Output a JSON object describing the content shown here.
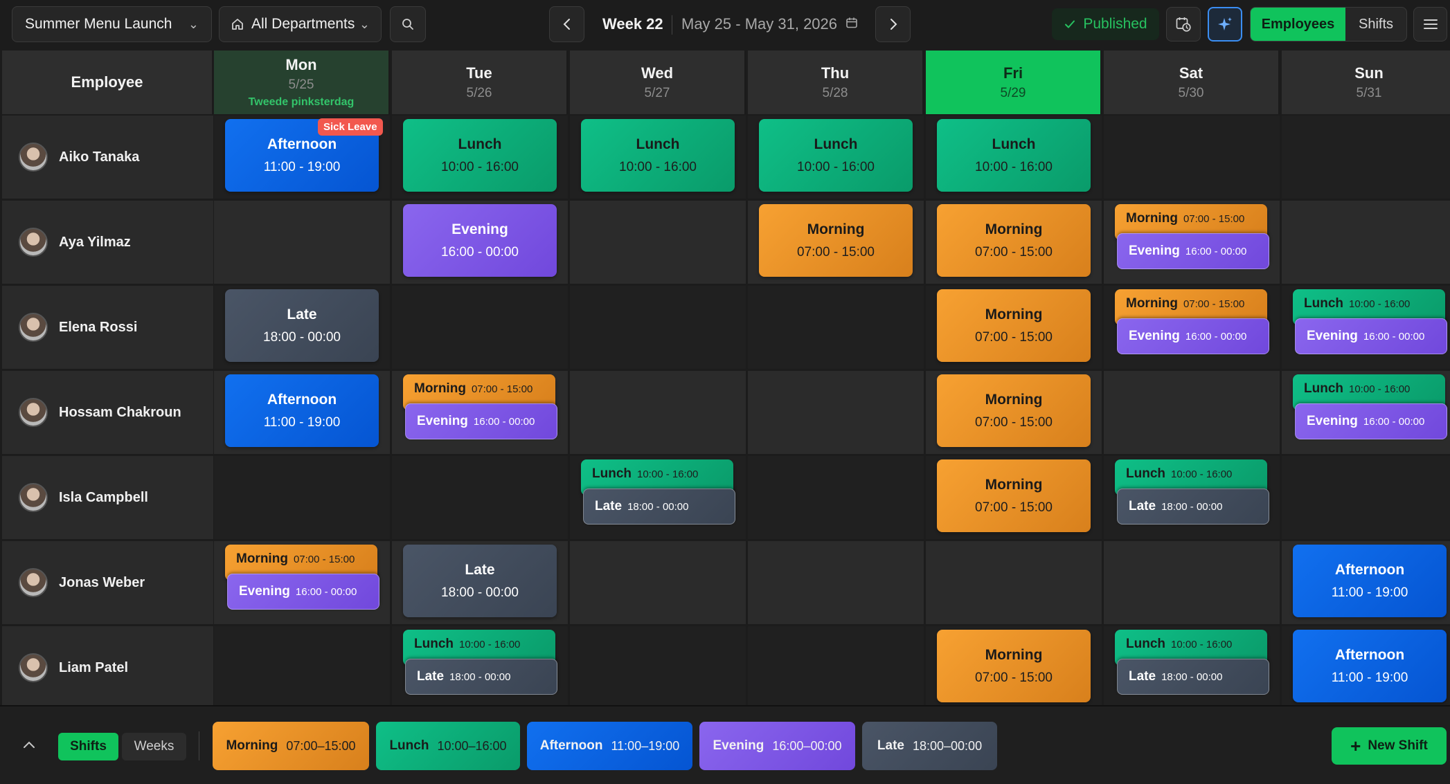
{
  "toolbar": {
    "project": "Summer Menu Launch",
    "department": "All Departments",
    "week_label": "Week 22",
    "date_range": "May 25 - May 31, 2026",
    "published": "Published",
    "view_employees": "Employees",
    "view_shifts": "Shifts",
    "accent": "#10c35c"
  },
  "grid": {
    "employee_header": "Employee",
    "days": [
      {
        "day": "Mon",
        "date": "5/25",
        "holiday": "Tweede pinksterdag"
      },
      {
        "day": "Tue",
        "date": "5/26",
        "holiday": ""
      },
      {
        "day": "Wed",
        "date": "5/27",
        "holiday": ""
      },
      {
        "day": "Thu",
        "date": "5/28",
        "holiday": ""
      },
      {
        "day": "Fri",
        "date": "5/29",
        "holiday": ""
      },
      {
        "day": "Sat",
        "date": "5/30",
        "holiday": ""
      },
      {
        "day": "Sun",
        "date": "5/31",
        "holiday": ""
      }
    ],
    "employees": [
      {
        "name": "Aiko Tanaka",
        "shifts": [
          [
            "Afternoon"
          ],
          [
            "Lunch"
          ],
          [
            "Lunch"
          ],
          [
            "Lunch"
          ],
          [
            "Lunch"
          ],
          [],
          []
        ],
        "badges": {
          "0": "Sick Leave"
        }
      },
      {
        "name": "Aya Yilmaz",
        "shifts": [
          [],
          [
            "Evening"
          ],
          [],
          [
            "Morning"
          ],
          [
            "Morning"
          ],
          [
            "Morning",
            "Evening"
          ],
          []
        ]
      },
      {
        "name": "Elena Rossi",
        "shifts": [
          [
            "Late"
          ],
          [],
          [],
          [],
          [
            "Morning"
          ],
          [
            "Morning",
            "Evening"
          ],
          [
            "Lunch",
            "Evening"
          ]
        ]
      },
      {
        "name": "Hossam Chakroun",
        "shifts": [
          [
            "Afternoon"
          ],
          [
            "Morning",
            "Evening"
          ],
          [],
          [],
          [
            "Morning"
          ],
          [],
          [
            "Lunch",
            "Evening"
          ]
        ]
      },
      {
        "name": "Isla Campbell",
        "shifts": [
          [],
          [],
          [
            "Lunch",
            "Late"
          ],
          [],
          [
            "Morning"
          ],
          [
            "Lunch",
            "Late"
          ],
          []
        ]
      },
      {
        "name": "Jonas Weber",
        "shifts": [
          [
            "Morning",
            "Evening"
          ],
          [
            "Late"
          ],
          [],
          [],
          [],
          [],
          [
            "Afternoon"
          ]
        ]
      },
      {
        "name": "Liam Patel",
        "shifts": [
          [],
          [
            "Lunch",
            "Late"
          ],
          [],
          [],
          [
            "Morning"
          ],
          [
            "Lunch",
            "Late"
          ],
          [
            "Afternoon"
          ]
        ]
      }
    ]
  },
  "shift_types": {
    "Morning": {
      "name": "Morning",
      "time": "07:00 - 15:00",
      "legend_time": "07:00–15:00",
      "cls": "c-morning",
      "color": "#f7a132"
    },
    "Lunch": {
      "name": "Lunch",
      "time": "10:00 - 16:00",
      "legend_time": "10:00–16:00",
      "cls": "c-lunch",
      "color": "#0fbf87"
    },
    "Afternoon": {
      "name": "Afternoon",
      "time": "11:00 - 19:00",
      "legend_time": "11:00–19:00",
      "cls": "c-afternoon",
      "color": "#1170ef"
    },
    "Evening": {
      "name": "Evening",
      "time": "16:00 - 00:00",
      "legend_time": "16:00–00:00",
      "cls": "c-evening",
      "color": "#8a66ee"
    },
    "Late": {
      "name": "Late",
      "time": "18:00 - 00:00",
      "legend_time": "18:00–00:00",
      "cls": "c-late",
      "color": "#4a5566"
    }
  },
  "footer": {
    "tab_shifts": "Shifts",
    "tab_weeks": "Weeks",
    "legend": [
      "Morning",
      "Lunch",
      "Afternoon",
      "Evening",
      "Late"
    ],
    "new_shift": "New Shift"
  }
}
